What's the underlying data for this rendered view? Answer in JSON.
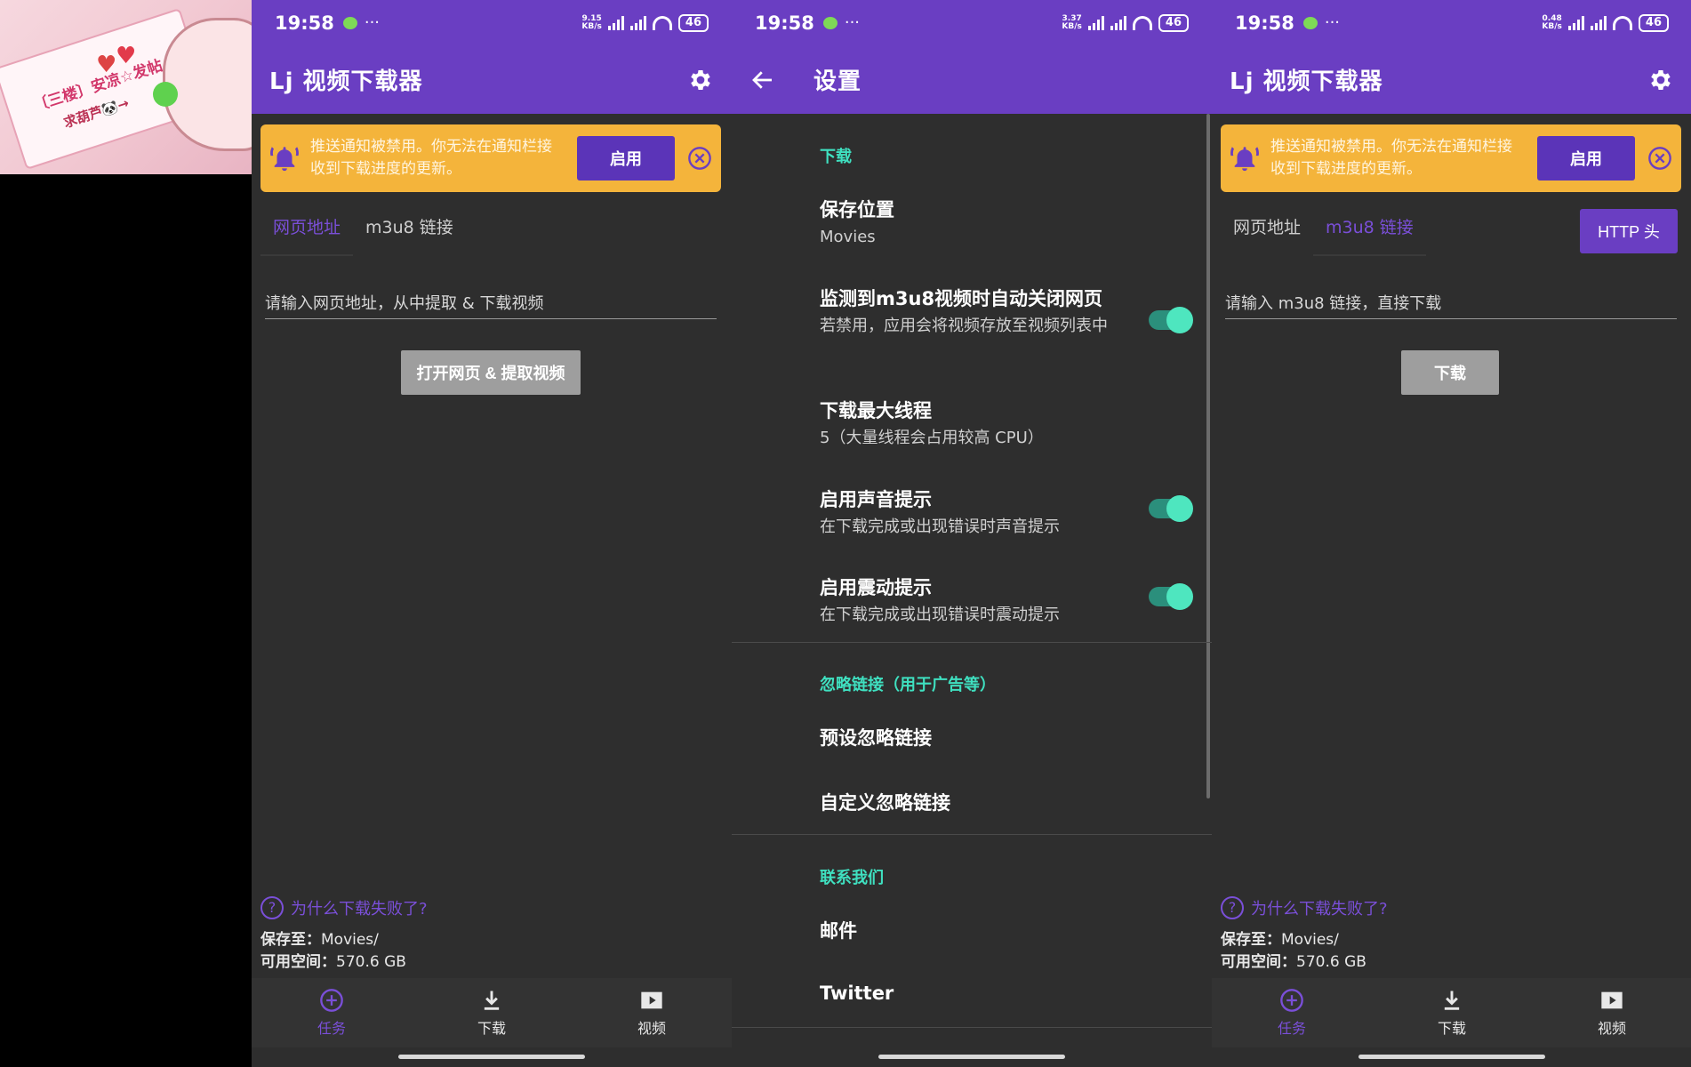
{
  "sticker": {
    "line1": "〔三楼〕安凉☆发帖",
    "line2": "求葫芦🐼→"
  },
  "status": {
    "time": "19:58",
    "dots": "···",
    "speed_1": "9.15",
    "speed_2": "3.37",
    "speed_3": "0.48",
    "speed_unit": "KB/s",
    "battery": "46"
  },
  "main": {
    "title": "Lj 视频下载器",
    "notice": {
      "message": "推送通知被禁用。你无法在通知栏接收到下载进度的更新。",
      "enable_label": "启用"
    },
    "tabs": [
      "网页地址",
      "m3u8 链接"
    ],
    "web": {
      "placeholder": "请输入网页地址，从中提取 & 下载视频",
      "button": "打开网页 & 提取视频"
    },
    "m3u8": {
      "placeholder": "请输入 m3u8 链接，直接下载",
      "button": "下载",
      "http_header": "HTTP 头"
    },
    "help": "为什么下载失败了?",
    "save_key": "保存至：",
    "save_val": "Movies/",
    "space_key": "可用空间：",
    "space_val": "570.6 GB",
    "nav": [
      "任务",
      "下载",
      "视频"
    ]
  },
  "settings": {
    "title": "设置",
    "sec_download": "下载",
    "save_location": {
      "title": "保存位置",
      "value": "Movies"
    },
    "auto_close": {
      "title": "监测到m3u8视频时自动关闭网页",
      "desc": "若禁用，应用会将视频存放至视频列表中"
    },
    "max_threads": {
      "title": "下载最大线程",
      "desc": "5（大量线程会占用较高 CPU）"
    },
    "sound": {
      "title": "启用声音提示",
      "desc": "在下载完成或出现错误时声音提示"
    },
    "vibrate": {
      "title": "启用震动提示",
      "desc": "在下载完成或出现错误时震动提示"
    },
    "sec_ignore": "忽略链接（用于广告等）",
    "preset_ignore": "预设忽略链接",
    "custom_ignore": "自定义忽略链接",
    "sec_contact": "联系我们",
    "email": "邮件",
    "twitter": "Twitter"
  }
}
